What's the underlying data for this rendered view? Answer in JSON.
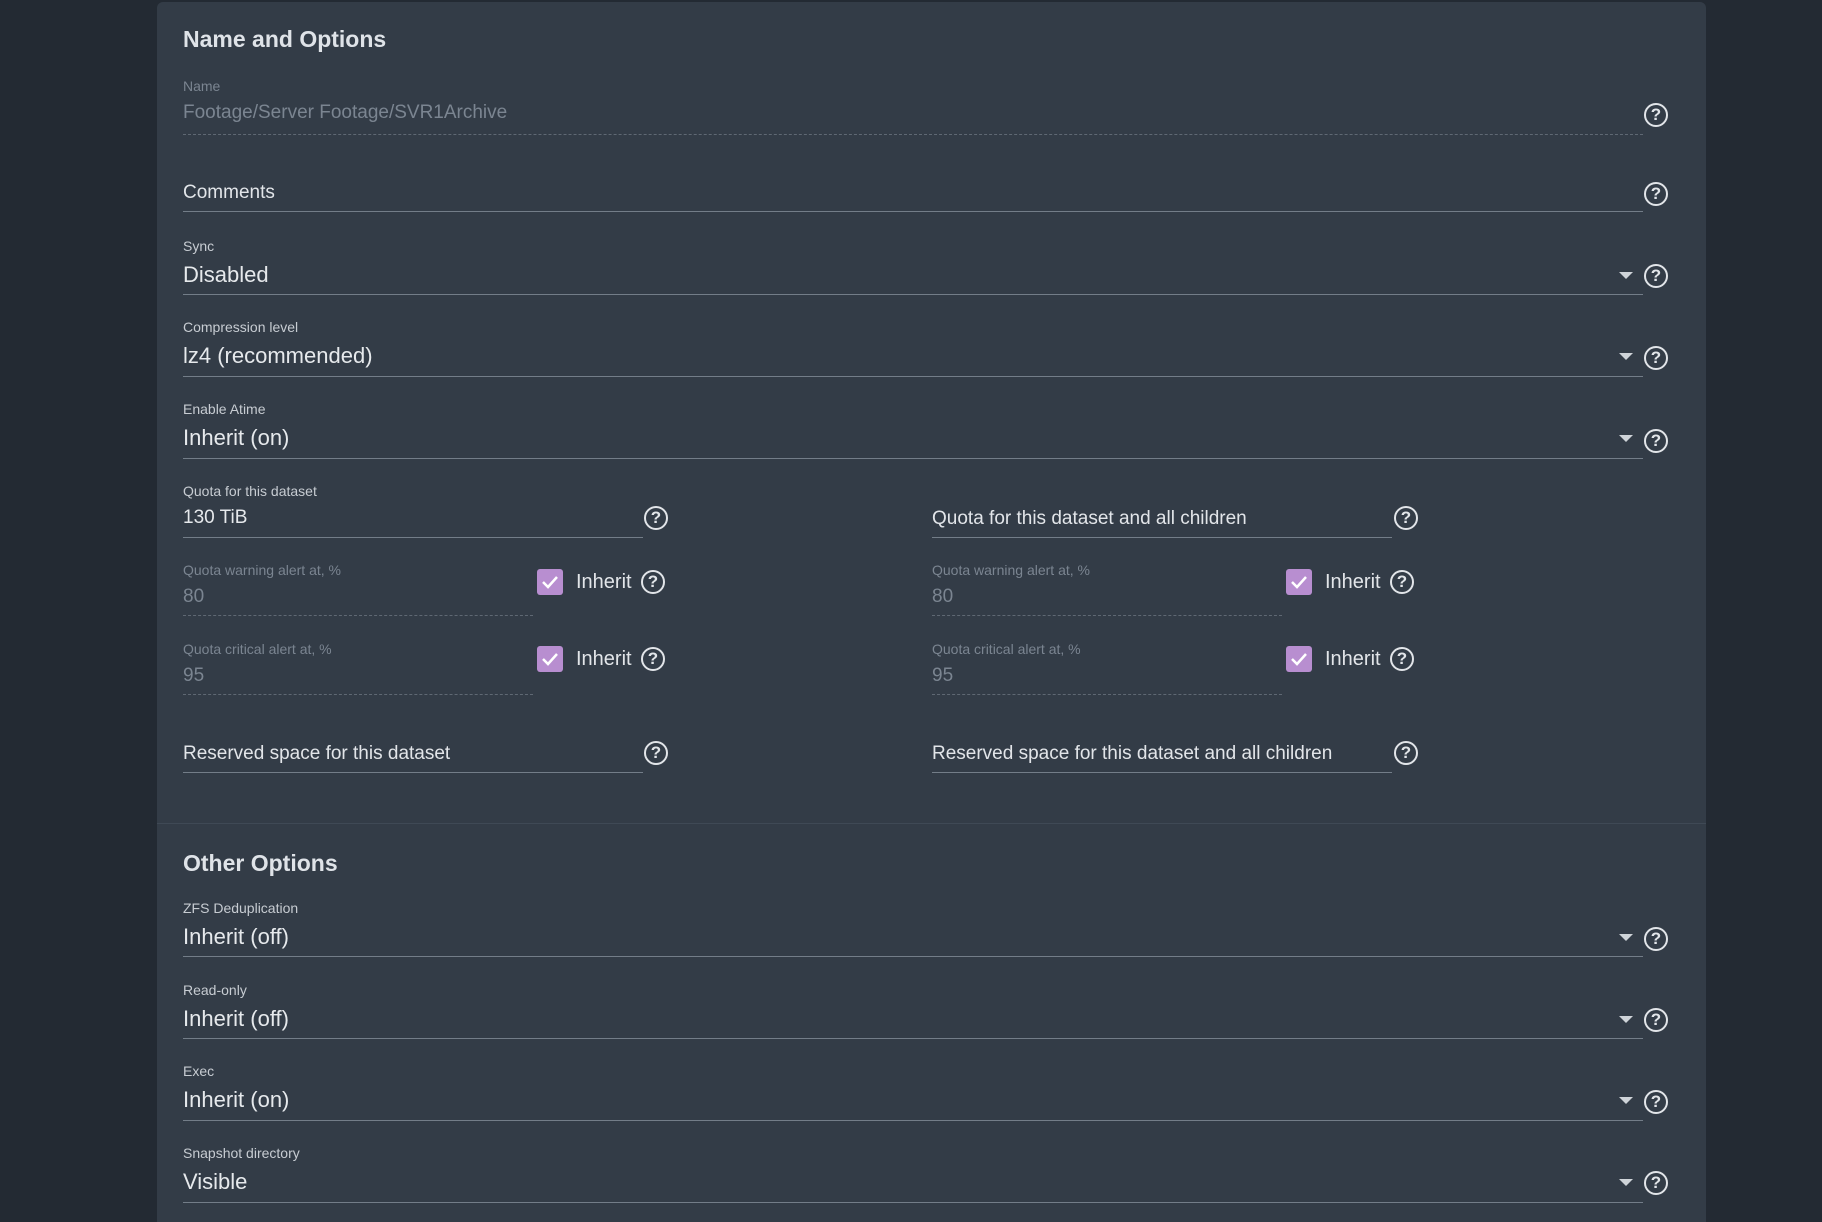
{
  "sections": {
    "name_options": "Name and Options",
    "other_options": "Other Options"
  },
  "name": {
    "label": "Name",
    "value": "Footage/Server Footage/SVR1Archive"
  },
  "comments": {
    "placeholder": "Comments"
  },
  "sync": {
    "label": "Sync",
    "value": "Disabled"
  },
  "compression": {
    "label": "Compression level",
    "value": "lz4 (recommended)"
  },
  "atime": {
    "label": "Enable Atime",
    "value": "Inherit (on)"
  },
  "quota": {
    "label": "Quota for this dataset",
    "value": "130 TiB",
    "children_placeholder": "Quota for this dataset and all children",
    "warning_label": "Quota warning alert at, %",
    "warning_value": "80",
    "critical_label": "Quota critical alert at, %",
    "critical_value": "95",
    "inherit_label": "Inherit"
  },
  "reserved": {
    "dataset_placeholder": "Reserved space for this dataset",
    "children_placeholder": "Reserved space for this dataset and all children"
  },
  "dedup": {
    "label": "ZFS Deduplication",
    "value": "Inherit (off)"
  },
  "readonly": {
    "label": "Read-only",
    "value": "Inherit (off)"
  },
  "exec": {
    "label": "Exec",
    "value": "Inherit (on)"
  },
  "snapdir": {
    "label": "Snapshot directory",
    "value": "Visible"
  },
  "help_glyph": "?",
  "colors": {
    "background": "#232a33",
    "card": "#333c47",
    "checkbox": "#b88ed0"
  }
}
